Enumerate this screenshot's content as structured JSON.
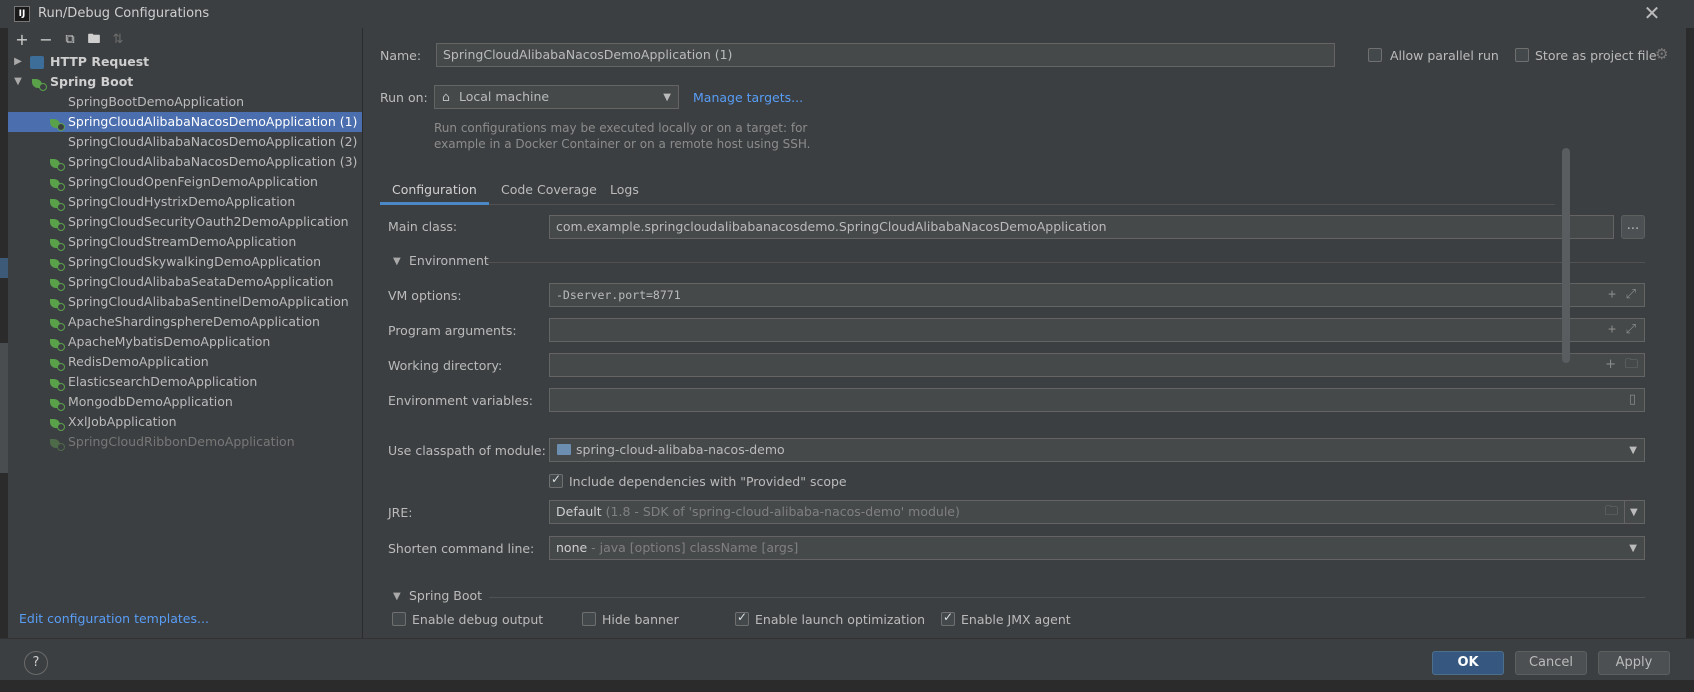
{
  "window": {
    "title": "Run/Debug Configurations",
    "app_icon_text": "IJ"
  },
  "toolbar": {
    "add": "+",
    "remove": "−",
    "copy": "⧉",
    "folder": "🖿",
    "sort": "⇅"
  },
  "tree": {
    "groups": [
      {
        "label": "HTTP Request",
        "expanded": false
      },
      {
        "label": "Spring Boot",
        "expanded": true
      }
    ],
    "items": [
      {
        "label": "SpringBootDemoApplication",
        "icon": "none",
        "selected": false,
        "disabled": false
      },
      {
        "label": "SpringCloudAlibabaNacosDemoApplication (1)",
        "icon": "spring-leaf-icon",
        "selected": true,
        "disabled": false
      },
      {
        "label": "SpringCloudAlibabaNacosDemoApplication (2)",
        "icon": "none",
        "selected": false,
        "disabled": false
      },
      {
        "label": "SpringCloudAlibabaNacosDemoApplication (3)",
        "icon": "spring-leaf-icon",
        "selected": false,
        "disabled": false
      },
      {
        "label": "SpringCloudOpenFeignDemoApplication",
        "icon": "spring-leaf-icon",
        "selected": false,
        "disabled": false
      },
      {
        "label": "SpringCloudHystrixDemoApplication",
        "icon": "spring-leaf-icon",
        "selected": false,
        "disabled": false
      },
      {
        "label": "SpringCloudSecurityOauth2DemoApplication",
        "icon": "spring-leaf-icon",
        "selected": false,
        "disabled": false
      },
      {
        "label": "SpringCloudStreamDemoApplication",
        "icon": "spring-leaf-icon",
        "selected": false,
        "disabled": false
      },
      {
        "label": "SpringCloudSkywalkingDemoApplication",
        "icon": "spring-leaf-icon",
        "selected": false,
        "disabled": false
      },
      {
        "label": "SpringCloudAlibabaSeataDemoApplication",
        "icon": "spring-leaf-icon",
        "selected": false,
        "disabled": false
      },
      {
        "label": "SpringCloudAlibabaSentinelDemoApplication",
        "icon": "spring-leaf-icon",
        "selected": false,
        "disabled": false
      },
      {
        "label": "ApacheShardingsphereDemoApplication",
        "icon": "spring-leaf-icon",
        "selected": false,
        "disabled": false
      },
      {
        "label": "ApacheMybatisDemoApplication",
        "icon": "spring-leaf-icon",
        "selected": false,
        "disabled": false
      },
      {
        "label": "RedisDemoApplication",
        "icon": "spring-leaf-icon",
        "selected": false,
        "disabled": false
      },
      {
        "label": "ElasticsearchDemoApplication",
        "icon": "spring-leaf-icon",
        "selected": false,
        "disabled": false
      },
      {
        "label": "MongodbDemoApplication",
        "icon": "spring-leaf-icon",
        "selected": false,
        "disabled": false
      },
      {
        "label": "XxlJobApplication",
        "icon": "spring-leaf-icon",
        "selected": false,
        "disabled": false
      },
      {
        "label": "SpringCloudRibbonDemoApplication",
        "icon": "spring-leaf-icon",
        "selected": false,
        "disabled": true
      }
    ],
    "edit_templates_link": "Edit configuration templates..."
  },
  "form": {
    "name_label": "Name:",
    "name_value": "SpringCloudAlibabaNacosDemoApplication (1)",
    "allow_parallel_label": "Allow parallel run",
    "allow_parallel_checked": false,
    "store_project_label": "Store as project file",
    "store_project_checked": false,
    "run_on_label": "Run on:",
    "run_on_value": "Local machine",
    "manage_targets_link": "Manage targets...",
    "run_on_hint_line1": "Run configurations may be executed locally or on a target: for",
    "run_on_hint_line2": "example in a Docker Container or on a remote host using SSH.",
    "tabs": [
      {
        "label": "Configuration",
        "active": true
      },
      {
        "label": "Code Coverage",
        "active": false
      },
      {
        "label": "Logs",
        "active": false
      }
    ],
    "main_class_label": "Main class:",
    "main_class_value": "com.example.springcloudalibabanacosdemo.SpringCloudAlibabaNacosDemoApplication",
    "browse_button": "...",
    "environment_section": "Environment",
    "vm_options_label": "VM options:",
    "vm_options_value": "-Dserver.port=8771",
    "program_args_label": "Program arguments:",
    "program_args_value": "",
    "working_dir_label": "Working directory:",
    "working_dir_value": "",
    "env_vars_label": "Environment variables:",
    "env_vars_value": "",
    "classpath_label": "Use classpath of module:",
    "classpath_value": "spring-cloud-alibaba-nacos-demo",
    "include_deps_label": "Include dependencies with \"Provided\" scope",
    "include_deps_checked": true,
    "jre_label": "JRE:",
    "jre_value_main": "Default",
    "jre_value_detail": " (1.8 - SDK of 'spring-cloud-alibaba-nacos-demo' module)",
    "shorten_label": "Shorten command line:",
    "shorten_value_main": "none",
    "shorten_value_detail": " - java [options] className [args]",
    "spring_boot_section": "Spring Boot",
    "enable_debug_label": "Enable debug output",
    "enable_debug_checked": false,
    "hide_banner_label": "Hide banner",
    "hide_banner_checked": false,
    "launch_opt_label": "Enable launch optimization",
    "launch_opt_checked": true,
    "jmx_label": "Enable JMX agent",
    "jmx_checked": true
  },
  "buttons": {
    "help": "?",
    "ok": "OK",
    "cancel": "Cancel",
    "apply": "Apply"
  },
  "colors": {
    "background": "#3c3f41",
    "selection": "#4b6eaf",
    "link": "#589df6",
    "primary_button": "#365880",
    "spring_green": "#5aa24a"
  }
}
